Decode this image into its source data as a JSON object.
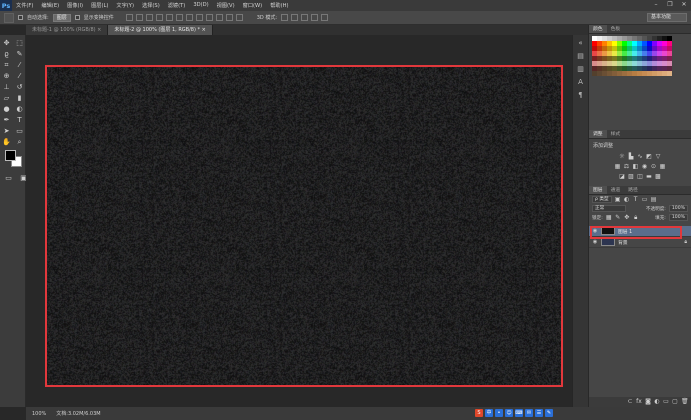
{
  "app": {
    "logo": "Ps"
  },
  "menu": [
    "文件(F)",
    "编辑(E)",
    "图像(I)",
    "图层(L)",
    "文字(Y)",
    "选择(S)",
    "滤镜(T)",
    "3D(D)",
    "视图(V)",
    "窗口(W)",
    "帮助(H)"
  ],
  "window_controls": {
    "minimize": "–",
    "restore": "❐",
    "close": "✕"
  },
  "options": {
    "auto_select_label": "自动选择:",
    "auto_select_value": "图层",
    "show_transform_label": "显示变换控件",
    "mode_3d_label": "3D 模式:",
    "workspace": "基本功能"
  },
  "tabs": [
    {
      "label": "未标题-1 @ 100% (RGB/8) ×",
      "active": false
    },
    {
      "label": "未标题-2 @ 100% (图层 1, RGB/8) * ×",
      "active": true
    }
  ],
  "panels": {
    "swatches_tabs": [
      "颜色",
      "色板"
    ],
    "adjust_tabs": [
      "调整",
      "样式"
    ],
    "adjust_title": "添加调整",
    "layers_tabs": [
      "图层",
      "通道",
      "路径"
    ],
    "kind_select": "ρ 类型",
    "blend_mode": "正常",
    "opacity_label": "不透明度:",
    "opacity_value": "100%",
    "lock_label": "锁定:",
    "fill_label": "填充:",
    "fill_value": "100%",
    "layers": [
      {
        "name": "图层 1",
        "selected": true,
        "thumb_color": "#111111"
      },
      {
        "name": "背景",
        "selected": false,
        "thumb_color": "#2d3550",
        "locked": true
      }
    ]
  },
  "status": {
    "zoom": "100%",
    "doc": "文档:3.02M/6.03M"
  },
  "tray_icons": [
    "S",
    "中",
    "•",
    "☺",
    "⌨",
    "✉",
    "☰",
    "✎"
  ],
  "colors": {
    "highlight": "#e2383c",
    "selected_layer": "#5b6e8c",
    "foreground": "#000000",
    "background": "#ffffff"
  }
}
